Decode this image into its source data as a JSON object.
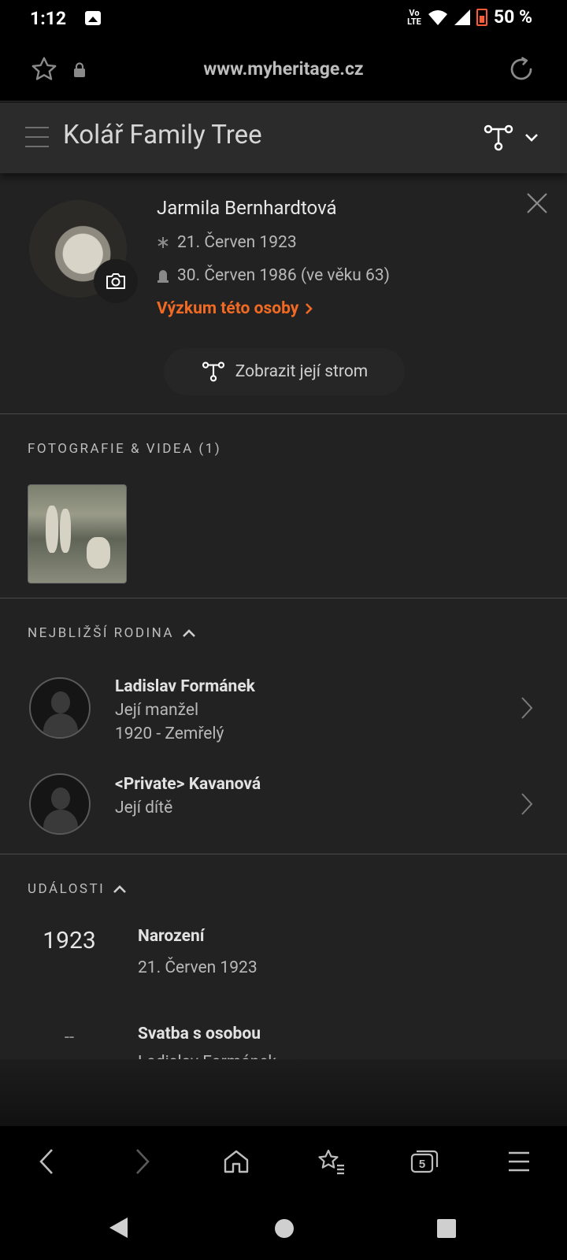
{
  "status_bar": {
    "time": "1:12",
    "volte_top": "Vo",
    "volte_bottom": "LTE",
    "battery": "50 %"
  },
  "browser": {
    "url": "www.myheritage.cz"
  },
  "header": {
    "title": "Kolář Family Tree"
  },
  "profile": {
    "name": "Jarmila Bernhardtová",
    "birth": "21. Červen 1923",
    "death": "30. Červen 1986 (ve věku 63)",
    "research_link": "Výzkum této osoby",
    "show_tree": "Zobrazit její strom"
  },
  "photos": {
    "title": "FOTOGRAFIE & VIDEA (1)"
  },
  "family": {
    "title": "NEJBLIŽŠÍ RODINA",
    "members": [
      {
        "name": "Ladislav Formánek",
        "relation": "Její manžel",
        "years": "1920 - Zemřelý"
      },
      {
        "name": "<Private> Kavanová",
        "relation": "Její dítě"
      }
    ]
  },
  "events": {
    "title": "UDÁLOSTI",
    "items": [
      {
        "year": "1923",
        "title": "Narození",
        "detail": "21. Červen 1923"
      },
      {
        "year": "--",
        "title": "Svatba s osobou",
        "detail": "Ladislav Formánek"
      }
    ]
  },
  "bottom_nav": {
    "tabs_count": "5"
  },
  "colors": {
    "accent": "#f06a23",
    "background": "#222222",
    "header": "#2b2b2b"
  },
  "icons": [
    "star-icon",
    "lock-icon",
    "reload-icon",
    "menu-icon",
    "tree-icon",
    "chevron-down-icon",
    "close-icon",
    "camera-icon",
    "asterisk-icon",
    "tombstone-icon",
    "chevron-right-icon",
    "chevron-up-icon",
    "back-icon",
    "forward-icon",
    "home-icon",
    "bookmarks-icon",
    "tabs-icon",
    "browser-menu-icon"
  ]
}
